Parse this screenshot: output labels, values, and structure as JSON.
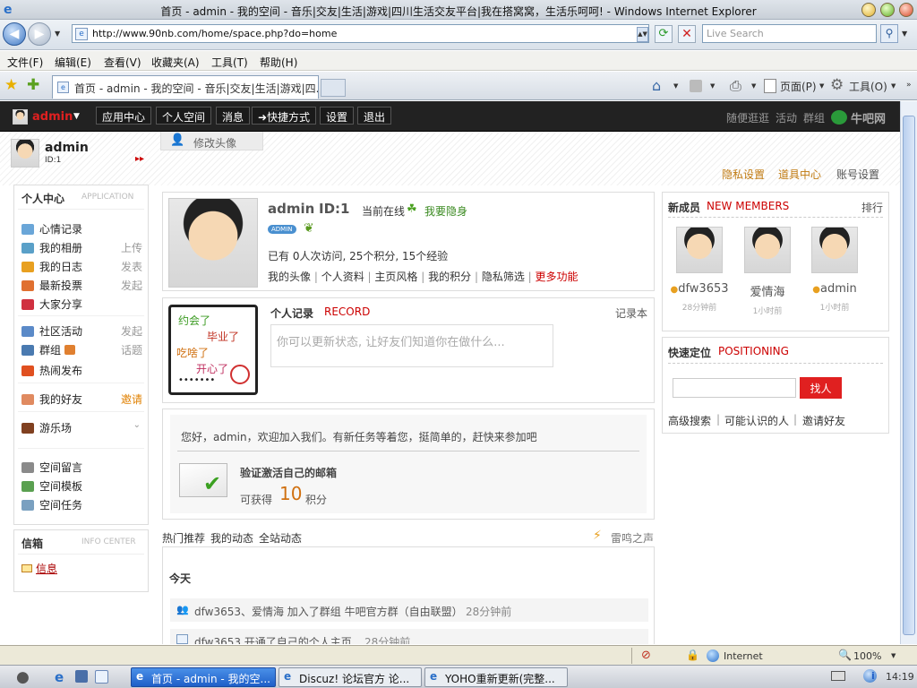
{
  "window": {
    "title": "首页 - admin - 我的空间 - 音乐|交友|生活|游戏|四川生活交友平台|我在搭窝窝，生活乐呵呵! - Windows Internet Explorer"
  },
  "browser": {
    "url": "http://www.90nb.com/home/space.php?do=home",
    "search_placeholder": "Live Search",
    "menu": [
      "文件(F)",
      "编辑(E)",
      "查看(V)",
      "收藏夹(A)",
      "工具(T)",
      "帮助(H)"
    ],
    "tab_title": "首页 - admin - 我的空间 - 音乐|交友|生活|游戏|四...",
    "toolbar_page": "页面(P)",
    "toolbar_tools": "工具(O)"
  },
  "site": {
    "brand": "admin",
    "nav": [
      "应用中心",
      "个人空间",
      "消息",
      "➜快捷方式",
      "设置",
      "退出"
    ],
    "right_links": [
      "随便逛逛",
      "活动",
      "群组"
    ],
    "logo": "牛吧网"
  },
  "header": {
    "username": "admin",
    "uid": "ID:1",
    "edit_avatar": "修改头像",
    "links": [
      "隐私设置",
      "道具中心",
      "账号设置"
    ]
  },
  "sidebar": {
    "title": "个人中心",
    "title_en": "APPLICATION",
    "items": [
      {
        "label": "心情记录",
        "right": "",
        "color": "#6aa6d8"
      },
      {
        "label": "我的相册",
        "right": "上传",
        "color": "#5aa0c8"
      },
      {
        "label": "我的日志",
        "right": "发表",
        "color": "#e8a020"
      },
      {
        "label": "最新投票",
        "right": "发起",
        "color": "#e07030"
      },
      {
        "label": "大家分享",
        "right": "",
        "color": "#d03040"
      },
      {
        "label": "社区活动",
        "right": "发起",
        "color": "#5b8ac8"
      },
      {
        "label": "群组",
        "right": "话题",
        "color": "#4a7ab0"
      },
      {
        "label": "热闹发布",
        "right": "",
        "color": "#e05020"
      },
      {
        "label": "我的好友",
        "right": "邀请",
        "color": "#e08a60"
      },
      {
        "label": "游乐场",
        "right": "",
        "color": "#804020"
      },
      {
        "label": "空间留言",
        "right": "",
        "color": "#8a8a8a"
      },
      {
        "label": "空间模板",
        "right": "",
        "color": "#5aa050"
      },
      {
        "label": "空间任务",
        "right": "",
        "color": "#7aa0c0"
      }
    ],
    "info_title": "信箱",
    "info_title_en": "INFO CENTER",
    "info_link": "信息"
  },
  "profile": {
    "name": "admin",
    "id": "ID:1",
    "online": "当前在线",
    "hide": "我要隐身",
    "badge": "ADMIN",
    "stats": "已有 0人次访问, 25个积分, 15个经验",
    "links": [
      "我的头像",
      "个人资料",
      "主页风格",
      "我的积分",
      "隐私筛选"
    ],
    "more": "更多功能"
  },
  "record": {
    "title": "个人记录",
    "title_en": "RECORD",
    "side": "记录本",
    "placeholder": "你可以更新状态, 让好友们知道你在做什么...",
    "art": [
      "约会了",
      "毕业了",
      "吃啥了",
      "开心了",
      "•••••••"
    ]
  },
  "task": {
    "welcome": "您好，admin，欢迎加入我们。有新任务等着您，挺简单的，赶快来参加吧",
    "name": "验证激活自己的邮箱",
    "earn": "可获得",
    "points": "10",
    "unit": "积分"
  },
  "feed": {
    "tabs": [
      "热门推荐",
      "我的动态",
      "全站动态"
    ],
    "thunder": "雷鸣之声",
    "today": "今天",
    "items": [
      {
        "text": "dfw3653、爱情海 加入了群组 牛吧官方群（自由联盟）",
        "time": "28分钟前"
      },
      {
        "text": "dfw3653 开通了自己的个人主页",
        "time": "28分钟前"
      }
    ]
  },
  "members": {
    "title": "新成员",
    "title_en": "NEW MEMBERS",
    "rank": "排行",
    "list": [
      {
        "name": "dfw3653",
        "time": "28分钟前"
      },
      {
        "name": "爱情海",
        "time": "1小时前"
      },
      {
        "name": "admin",
        "time": "1小时前"
      }
    ]
  },
  "positioning": {
    "title": "快速定位",
    "title_en": "POSITIONING",
    "button": "找人",
    "links": [
      "高级搜索",
      "可能认识的人",
      "邀请好友"
    ]
  },
  "status": {
    "zone": "Internet",
    "zoom": "100%"
  },
  "taskbar": {
    "items": [
      "首页 - admin - 我的空...",
      "Discuz! 论坛官方 论...",
      "YOHO重新更新(完整..."
    ],
    "clock": "14:19"
  }
}
